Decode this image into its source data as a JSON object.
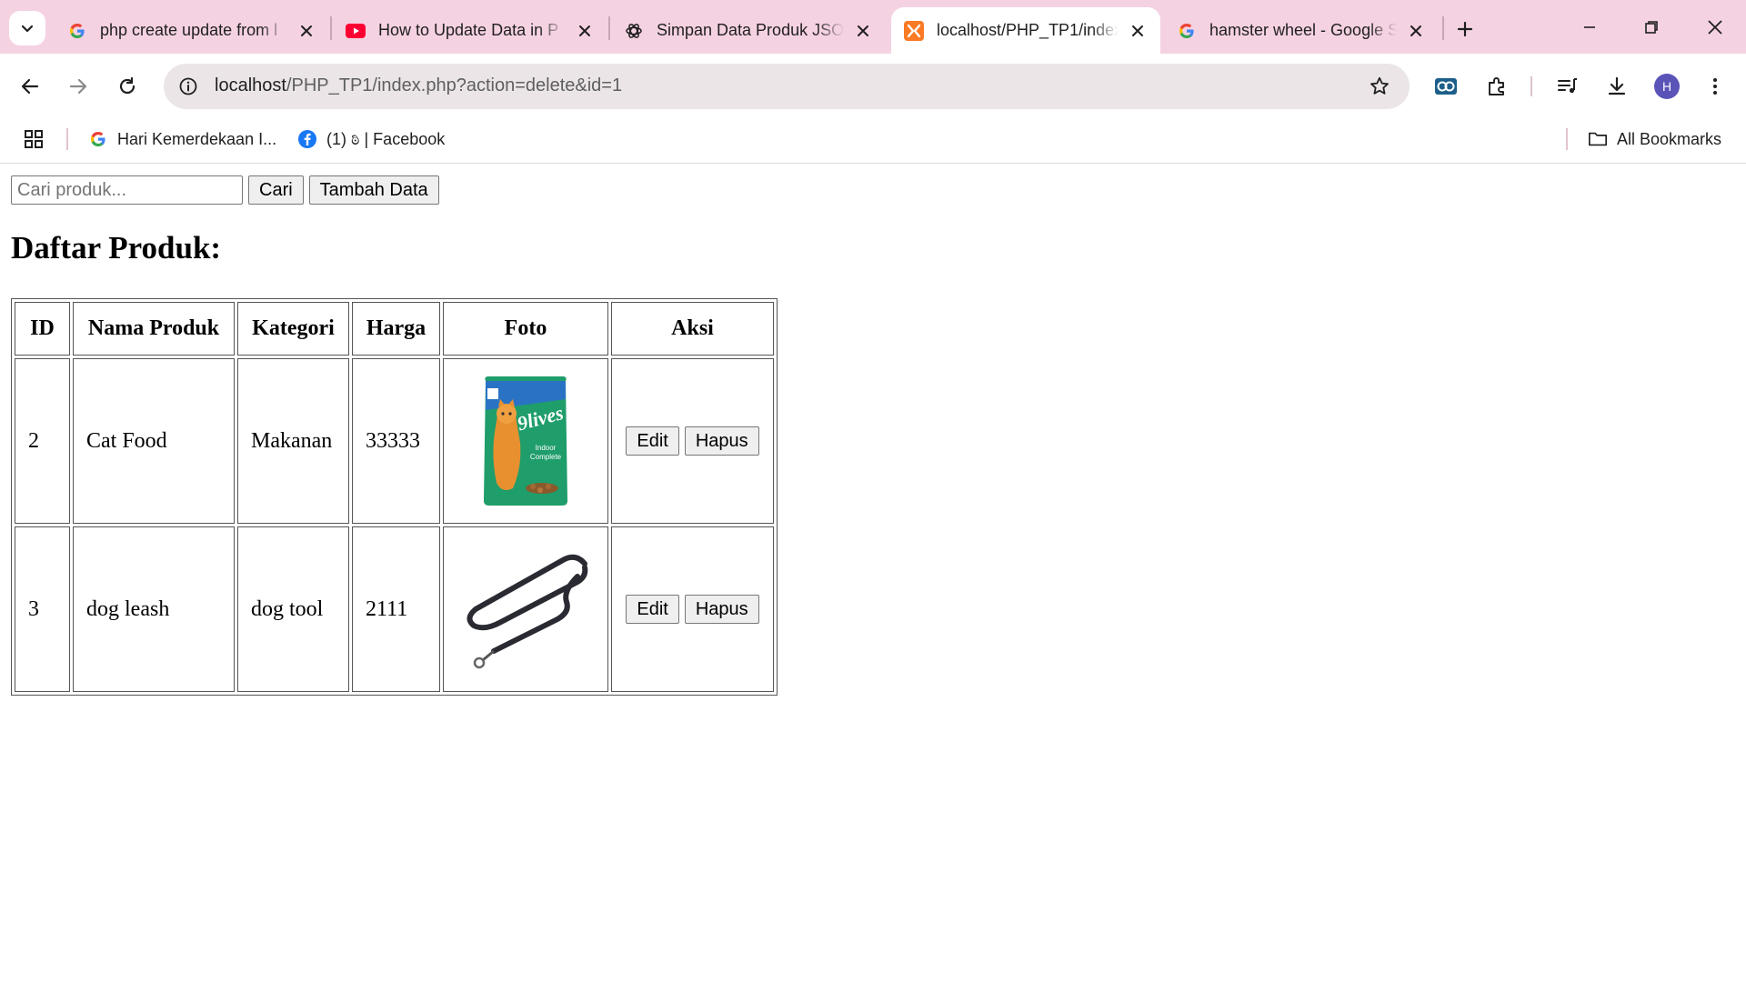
{
  "browser": {
    "tabs": [
      {
        "title": "php create update from l",
        "favicon": "google-icon"
      },
      {
        "title": "How to Update Data in P",
        "favicon": "youtube-icon"
      },
      {
        "title": "Simpan Data Produk JSO",
        "favicon": "chatgpt-icon"
      },
      {
        "title": "localhost/PHP_TP1/index",
        "favicon": "xampp-icon",
        "active": true
      },
      {
        "title": "hamster wheel - Google S",
        "favicon": "google-icon"
      }
    ],
    "url_host": "localhost",
    "url_path": "/PHP_TP1/index.php?action=delete&id=1",
    "bookmarks": [
      {
        "label": "Hari Kemerdekaan I...",
        "icon": "google-icon"
      },
      {
        "label": "(1) ಠಿ | Facebook",
        "icon": "facebook-icon"
      }
    ],
    "all_bookmarks_label": "All Bookmarks",
    "profile_initial": "H"
  },
  "page": {
    "search_placeholder": "Cari produk...",
    "search_button": "Cari",
    "add_button": "Tambah Data",
    "heading": "Daftar Produk:",
    "columns": [
      "ID",
      "Nama Produk",
      "Kategori",
      "Harga",
      "Foto",
      "Aksi"
    ],
    "rows": [
      {
        "id": "2",
        "name": "Cat Food",
        "category": "Makanan",
        "price": "33333",
        "photo": "cat-food-bag-image",
        "edit": "Edit",
        "delete": "Hapus"
      },
      {
        "id": "3",
        "name": "dog leash",
        "category": "dog tool",
        "price": "2111",
        "photo": "dog-leash-image",
        "edit": "Edit",
        "delete": "Hapus"
      }
    ],
    "photo_text": {
      "brand": "9lives",
      "line1": "Indoor",
      "line2": "Complete"
    }
  },
  "colors": {
    "tabstrip": "#f5d2e2",
    "omnibox": "#ebe5e8",
    "accent_avatar": "#5a54b8"
  }
}
